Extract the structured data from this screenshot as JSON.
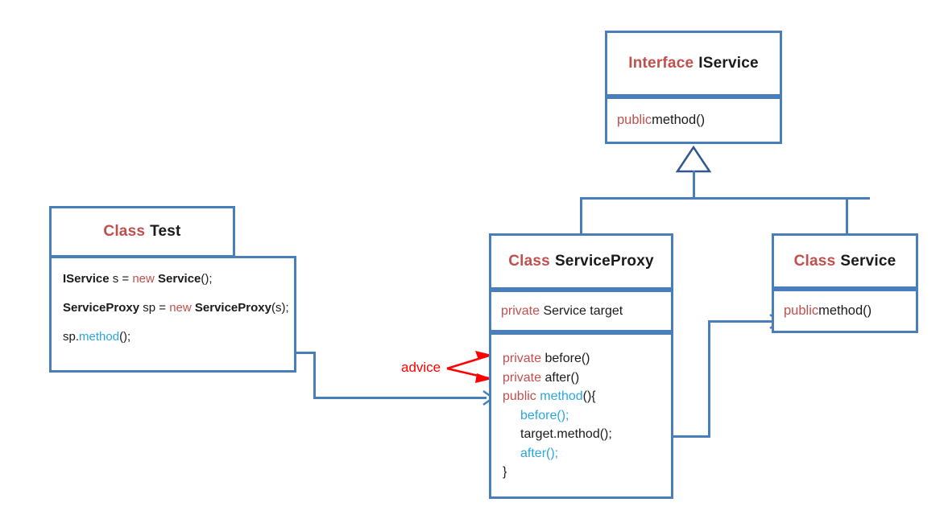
{
  "diagram": {
    "title": "Proxy pattern UML class diagram",
    "colors": {
      "box_border": "#4A7EBB",
      "keyword": "#C0504D",
      "method": "#2BA6DE",
      "advice": "#FF0000",
      "text": "#111111",
      "background": "#FFFFFF"
    }
  },
  "interface_iservice": {
    "stereotype": "Interface",
    "name": "IService",
    "members": [
      {
        "modifier": "public",
        "signature": "method()"
      }
    ]
  },
  "class_test": {
    "stereotype": "Class",
    "name": "Test",
    "lines": [
      {
        "type": "IService",
        "var": " s = ",
        "kw": "new",
        "ctor": "Service",
        "tail": "();"
      },
      {
        "type": "ServiceProxy",
        "var": " sp = ",
        "kw": "new",
        "ctor": "ServiceProxy",
        "tail": "(s);"
      },
      {
        "obj": "sp.",
        "call": "method",
        "tail": "();"
      }
    ]
  },
  "class_serviceproxy": {
    "stereotype": "Class",
    "name": "ServiceProxy",
    "field": {
      "modifier": "private",
      "text": "Service target"
    },
    "methods": [
      {
        "modifier": "private",
        "name": "before()"
      },
      {
        "modifier": "private",
        "name": "after()"
      },
      {
        "modifier": "public",
        "name": "method",
        "tail": "(){"
      }
    ],
    "body": [
      {
        "call": "before",
        "tail": "();",
        "blue": true
      },
      {
        "call": "target.method();",
        "blue": false
      },
      {
        "call": "after",
        "tail": "();",
        "blue": true
      }
    ],
    "close_brace": "}"
  },
  "class_service": {
    "stereotype": "Class",
    "name": "Service",
    "members": [
      {
        "modifier": "public",
        "signature": "method()"
      }
    ]
  },
  "annotations": {
    "advice_label": "advice"
  }
}
